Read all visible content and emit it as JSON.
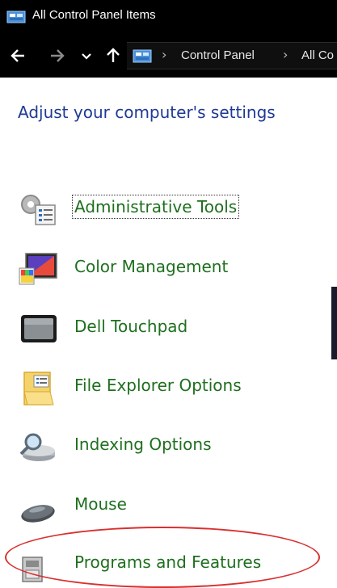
{
  "window": {
    "title": "All Control Panel Items"
  },
  "address": {
    "crumbs": [
      "Control Panel",
      "All Co"
    ]
  },
  "main": {
    "heading": "Adjust your computer's settings",
    "items": [
      {
        "label": "Administrative Tools",
        "icon": "admin-tools-icon"
      },
      {
        "label": "Color Management",
        "icon": "color-management-icon"
      },
      {
        "label": "Dell Touchpad",
        "icon": "touchpad-icon"
      },
      {
        "label": "File Explorer Options",
        "icon": "folder-options-icon"
      },
      {
        "label": "Indexing Options",
        "icon": "indexing-icon"
      },
      {
        "label": "Mouse",
        "icon": "mouse-icon"
      },
      {
        "label": "Programs and Features",
        "icon": "programs-features-icon"
      }
    ]
  },
  "colors": {
    "titlebar": "#000000",
    "heading": "#1f3a93",
    "link": "#1e6f1e",
    "highlight": "#d93030"
  }
}
